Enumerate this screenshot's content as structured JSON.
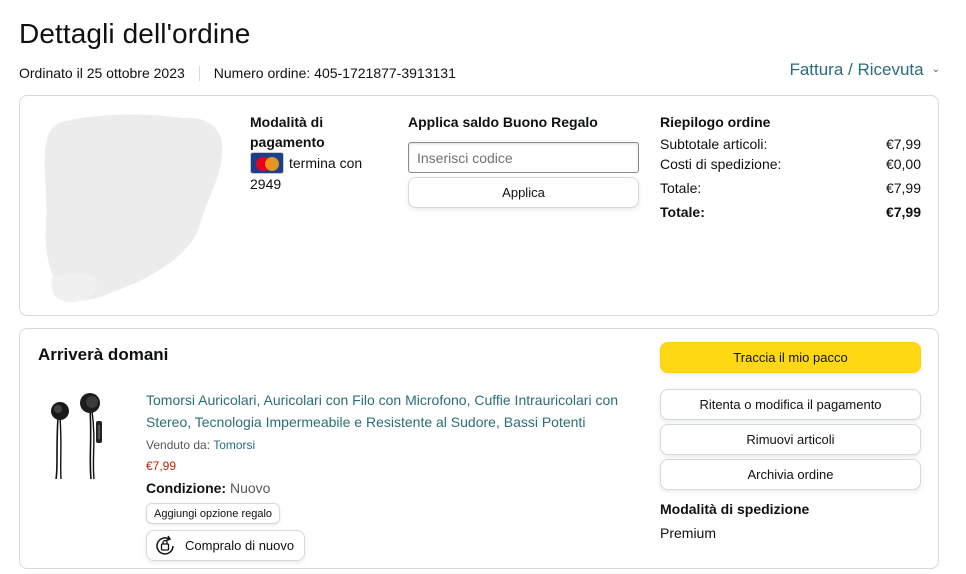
{
  "header": {
    "title": "Dettagli dell'ordine",
    "ordered_on": "Ordinato il 25 ottobre 2023",
    "order_number": "Numero ordine: 405-1721877-3913131",
    "invoice_link": "Fattura / Ricevuta"
  },
  "payment": {
    "heading": "Modalità di pagamento",
    "card_text": "termina con",
    "card_digits": "2949",
    "card_icon": "mastercard-icon"
  },
  "gift_card": {
    "heading": "Applica saldo Buono Regalo",
    "input_placeholder": "Inserisci codice",
    "apply_label": "Applica"
  },
  "summary": {
    "heading": "Riepilogo ordine",
    "rows": [
      {
        "label": "Subtotale articoli:",
        "value": "€7,99"
      },
      {
        "label": "Costi di spedizione:",
        "value": "€0,00"
      },
      {
        "label": "Totale:",
        "value": "€7,99"
      }
    ],
    "grand_label": "Totale:",
    "grand_value": "€7,99"
  },
  "shipment": {
    "heading": "Arriverà domani",
    "product": {
      "title": "Tomorsi Auricolari, Auricolari con Filo con Microfono, Cuffie Intrauricolari con Stereo, Tecnologia Impermeabile e Resistente al Sudore, Bassi Potenti",
      "sold_by_label": "Venduto da:",
      "seller": "Tomorsi",
      "price": "€7,99",
      "condition_label": "Condizione:",
      "condition_value": "Nuovo",
      "gift_option_label": "Aggiungi opzione regalo",
      "buy_again_label": "Compralo di nuovo"
    },
    "actions": {
      "track": "Traccia il mio pacco",
      "retry_payment": "Ritenta o modifica il pagamento",
      "remove_items": "Rimuovi articoli",
      "archive": "Archivia ordine"
    },
    "shipping_method_heading": "Modalità di spedizione",
    "shipping_method_value": "Premium"
  },
  "colors": {
    "link": "#2a6d7a",
    "price": "#b12704",
    "primary_button": "#ffd814",
    "border": "#d5d9d9"
  }
}
